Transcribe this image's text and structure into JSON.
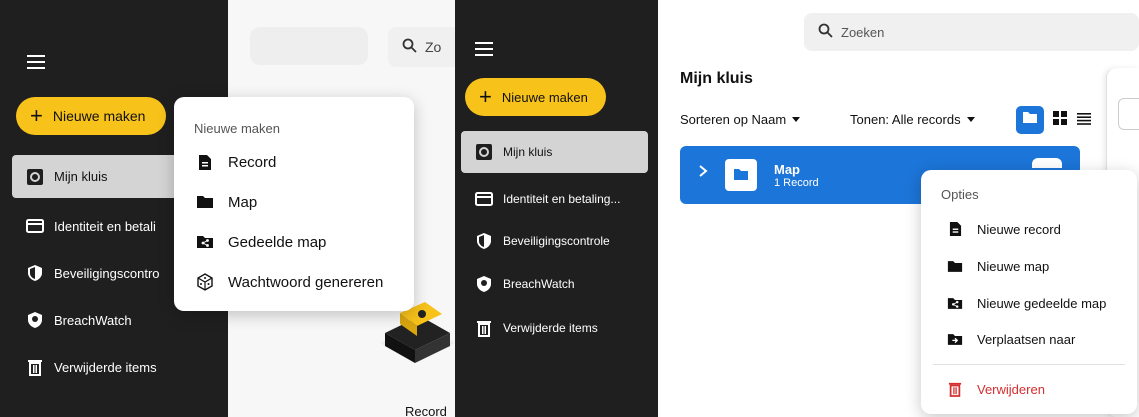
{
  "left": {
    "sidebar": {
      "new_button": "Nieuwe maken",
      "items": [
        {
          "label": "Mijn kluis",
          "icon": "vault-icon",
          "active": true
        },
        {
          "label": "Identiteit en betali",
          "icon": "card-icon"
        },
        {
          "label": "Beveiligingscontro",
          "icon": "shield-icon"
        },
        {
          "label": "BreachWatch",
          "icon": "breachwatch-icon"
        },
        {
          "label": "Verwijderde items",
          "icon": "trash-icon"
        }
      ]
    },
    "search": {
      "text": "Zo"
    },
    "new_menu": {
      "title": "Nieuwe maken",
      "items": [
        {
          "label": "Record",
          "icon": "document-icon"
        },
        {
          "label": "Map",
          "icon": "folder-icon"
        },
        {
          "label": "Gedeelde map",
          "icon": "shared-folder-icon"
        },
        {
          "label": "Wachtwoord genereren",
          "icon": "dice-icon"
        }
      ]
    },
    "bottom_text": "Record"
  },
  "right": {
    "sidebar": {
      "new_button": "Nieuwe maken",
      "items": [
        {
          "label": "Mijn kluis",
          "icon": "vault-icon",
          "active": true
        },
        {
          "label": "Identiteit en betaling...",
          "icon": "card-icon"
        },
        {
          "label": "Beveiligingscontrole",
          "icon": "shield-icon"
        },
        {
          "label": "BreachWatch",
          "icon": "breachwatch-icon"
        },
        {
          "label": "Verwijderde items",
          "icon": "trash-icon"
        }
      ]
    },
    "search": {
      "placeholder": "Zoeken"
    },
    "page_title": "Mijn kluis",
    "sort_label": "Sorteren op Naam",
    "show_label": "Tonen: Alle records",
    "folder": {
      "name": "Map",
      "count": "1 Record"
    },
    "options_menu": {
      "title": "Opties",
      "items": [
        {
          "label": "Nieuwe record",
          "icon": "document-icon"
        },
        {
          "label": "Nieuwe map",
          "icon": "folder-icon"
        },
        {
          "label": "Nieuwe gedeelde map",
          "icon": "shared-folder-icon"
        },
        {
          "label": "Verplaatsen naar",
          "icon": "move-icon"
        }
      ],
      "delete_label": "Verwijderen"
    }
  },
  "colors": {
    "accent_yellow": "#f7c21a",
    "sidebar_bg": "#1f1f1f",
    "folder_blue": "#1c75d8",
    "danger_red": "#d32f2f"
  }
}
